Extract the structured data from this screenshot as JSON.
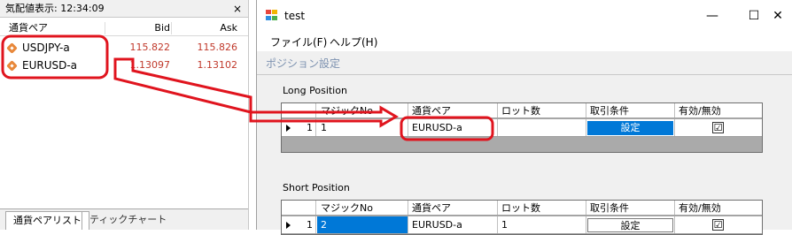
{
  "market_watch": {
    "title": "気配値表示: 12:34:09",
    "close": "×",
    "columns": {
      "symbol": "通貨ペア",
      "bid": "Bid",
      "ask": "Ask"
    },
    "rows": [
      {
        "symbol": "USDJPY-a",
        "bid": "115.822",
        "ask": "115.826"
      },
      {
        "symbol": "EURUSD-a",
        "bid": "1.13097",
        "ask": "1.13102"
      }
    ],
    "tabs": [
      "通貨ペアリスト",
      "ティックチャート"
    ]
  },
  "window": {
    "title": "test",
    "controls": {
      "minimize": "—",
      "maximize": "☐",
      "close": "✕"
    },
    "menu": [
      "ファイル(F)",
      "ヘルプ(H)"
    ],
    "position_settings_label": "ポジション設定",
    "long": {
      "label": "Long Position",
      "columns": [
        "マジックNo",
        "通貨ペア",
        "ロット数",
        "取引条件",
        "有効/無効"
      ],
      "row": {
        "num": "1",
        "magic": "1",
        "pair": "EURUSD-a",
        "lots": "",
        "button": "設定",
        "enabled": "☑"
      }
    },
    "short": {
      "label": "Short Position",
      "columns": [
        "マジックNo",
        "通貨ペア",
        "ロット数",
        "取引条件",
        "有効/無効"
      ],
      "row": {
        "num": "1",
        "magic": "2",
        "pair": "EURUSD-a",
        "lots": "1",
        "button": "設定",
        "enabled": "☑"
      }
    }
  },
  "colors": {
    "annotation": "#e0141e",
    "price": "#c0392b",
    "selection": "#0078d7",
    "section_label": "#7d92b0"
  }
}
